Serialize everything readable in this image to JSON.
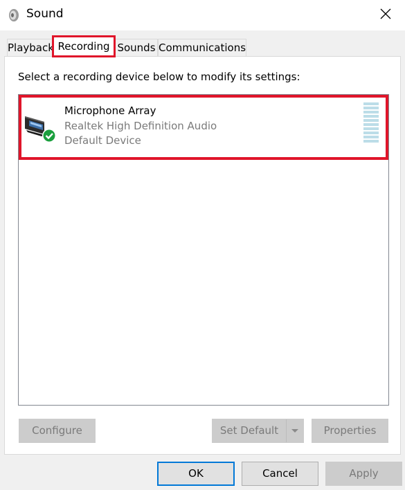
{
  "window": {
    "title": "Sound",
    "close_icon": "close-icon",
    "app_icon": "speaker-icon"
  },
  "tabs": [
    {
      "label": "Playback",
      "active": false
    },
    {
      "label": "Recording",
      "active": true
    },
    {
      "label": "Sounds",
      "active": false
    },
    {
      "label": "Communications",
      "active": false
    }
  ],
  "recording": {
    "instruction": "Select a recording device below to modify its settings:",
    "devices": [
      {
        "name": "Microphone Array",
        "driver": "Realtek High Definition Audio",
        "status": "Default Device",
        "icon": "microphone-array-icon",
        "status_icon": "green-check-icon",
        "selected": true
      }
    ]
  },
  "buttons": {
    "configure": "Configure",
    "set_default": "Set Default",
    "properties": "Properties",
    "ok": "OK",
    "cancel": "Cancel",
    "apply": "Apply"
  },
  "colors": {
    "highlight": "#e0152a",
    "focus": "#0078d7",
    "check": "#1a9f3d",
    "meter": "#bcdde8"
  }
}
